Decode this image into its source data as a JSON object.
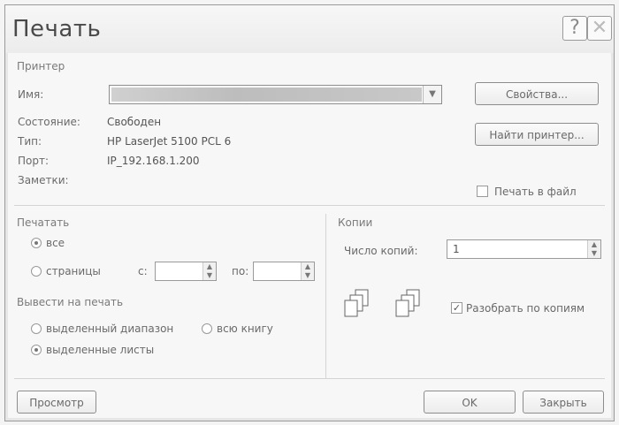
{
  "dialog": {
    "title": "Печать",
    "help_glyph": "?",
    "close_glyph": "✕"
  },
  "printer": {
    "group_label": "Принтер",
    "name_label": "Имя:",
    "status_label": "Состояние:",
    "status_value": "Свободен",
    "type_label": "Тип:",
    "type_value": "HP LaserJet 5100 PCL 6",
    "port_label": "Порт:",
    "port_value": "IP_192.168.1.200",
    "notes_label": "Заметки:",
    "properties_button": "Свойства...",
    "find_button": "Найти принтер...",
    "print_to_file_label": "Печать в файл"
  },
  "print_range": {
    "group_label": "Печатать",
    "all_label": "все",
    "pages_label": "страницы",
    "from_label": "с:",
    "to_label": "по:"
  },
  "print_what": {
    "group_label": "Вывести на печать",
    "selection_label": "выделенный диапазон",
    "workbook_label": "всю книгу",
    "sheets_label": "выделенные листы"
  },
  "copies": {
    "group_label": "Копии",
    "count_label": "Число копий:",
    "count_value": "1",
    "collate_label": "Разобрать по копиям"
  },
  "footer": {
    "preview_button": "Просмотр",
    "ok_button": "OK",
    "close_button": "Закрыть"
  }
}
